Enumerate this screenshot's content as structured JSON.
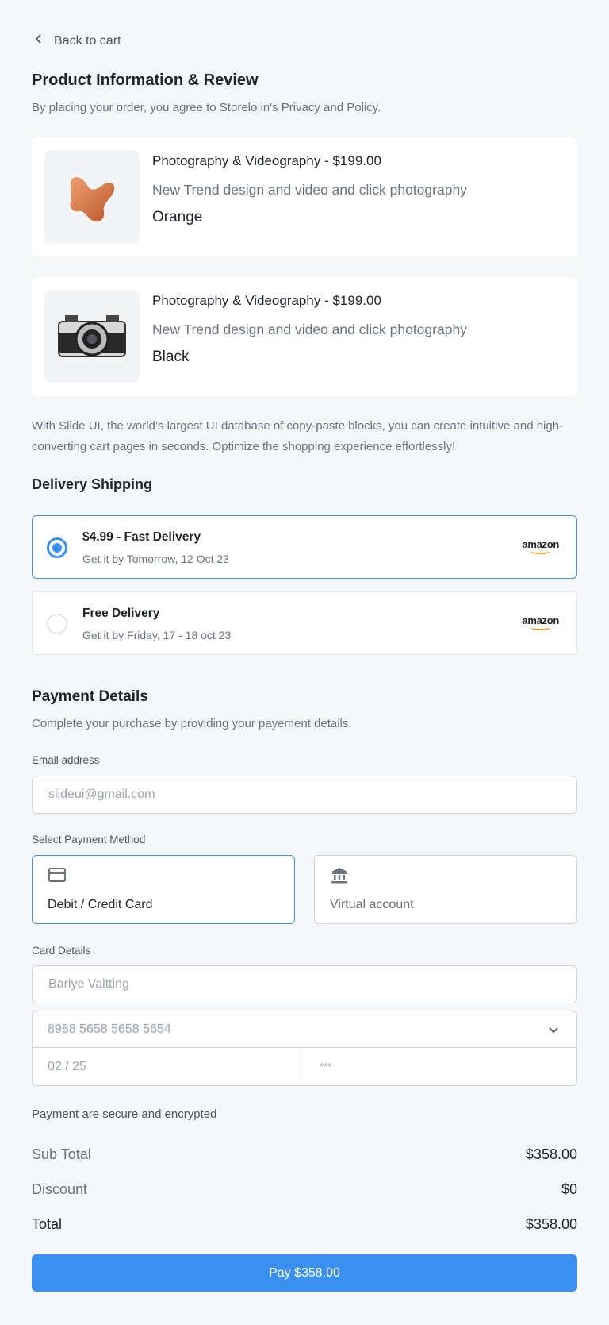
{
  "back_label": "Back to cart",
  "product_section": {
    "title": "Product Information & Review",
    "subtitle": "By placing your order, you agree to Storelo in's Privacy and Policy."
  },
  "products": [
    {
      "title": "Photography & Videography - $199.00",
      "description": "New Trend design and video and click photography",
      "color": "Orange",
      "image": "orange-chair"
    },
    {
      "title": "Photography & Videography - $199.00",
      "description": "New Trend design and video and click photography",
      "color": "Black",
      "image": "vintage-camera"
    }
  ],
  "info_paragraph": "With Slide UI, the world’s largest UI database of copy-paste blocks, you can create intuitive and high-converting cart pages in seconds. Optimize the shopping experience effortlessly!",
  "delivery": {
    "title": "Delivery Shipping",
    "options": [
      {
        "title": "$4.99 - Fast Delivery",
        "date": "Get it by Tomorrow, 12 Oct 23",
        "carrier": "amazon",
        "selected": true
      },
      {
        "title": "Free Delivery",
        "date": "Get it by Friday, 17 - 18 oct 23",
        "carrier": "amazon",
        "selected": false
      }
    ]
  },
  "payment": {
    "title": "Payment Details",
    "subtitle": "Complete your purchase by providing your payement details.",
    "email_label": "Email address",
    "email_placeholder": "slideui@gmail.com",
    "method_label": "Select Payment Method",
    "methods": [
      {
        "label": "Debit / Credit Card",
        "icon": "credit-card-icon",
        "selected": true
      },
      {
        "label": "Virtual account",
        "icon": "bank-icon",
        "selected": false
      }
    ],
    "card_label": "Card Details",
    "card_name": "Barlye Valtting",
    "card_number": "8988 5658 5658 5654",
    "card_expiry": "02 / 25",
    "card_cvv": "***",
    "secure_note": "Payment are secure and encrypted"
  },
  "summary": {
    "subtotal_label": "Sub Total",
    "subtotal": "$358.00",
    "discount_label": "Discount",
    "discount": "$0",
    "total_label": "Total",
    "total": "$358.00"
  },
  "pay_button": "Pay $358.00",
  "colors": {
    "accent": "#3b8ff0",
    "background": "#f5f6f8"
  }
}
